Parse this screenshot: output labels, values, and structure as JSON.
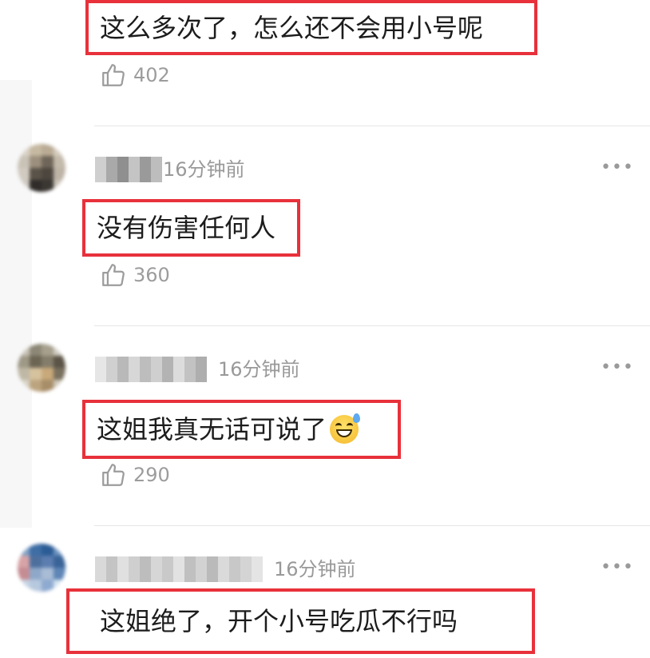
{
  "comments": [
    {
      "text": "这么多次了，怎么还不会用小号呢",
      "likes": "402"
    },
    {
      "time": "16分钟前",
      "text": "没有伤害任何人",
      "likes": "360"
    },
    {
      "time": "16分钟前",
      "text": "这姐我真无话可说了",
      "emoji": "grinning-sweat-emoji",
      "likes": "290"
    },
    {
      "time": "16分钟前",
      "text": "这姐绝了，开个小号吃瓜不行吗"
    }
  ],
  "more_glyph": "•••",
  "colors": {
    "highlight_border": "#e8313b",
    "meta_gray": "#999999",
    "divider": "#e6e6e6"
  },
  "icons": {
    "like": "thumbs-up-icon",
    "more": "more-dots-icon",
    "avatar": "blurred-avatar"
  }
}
